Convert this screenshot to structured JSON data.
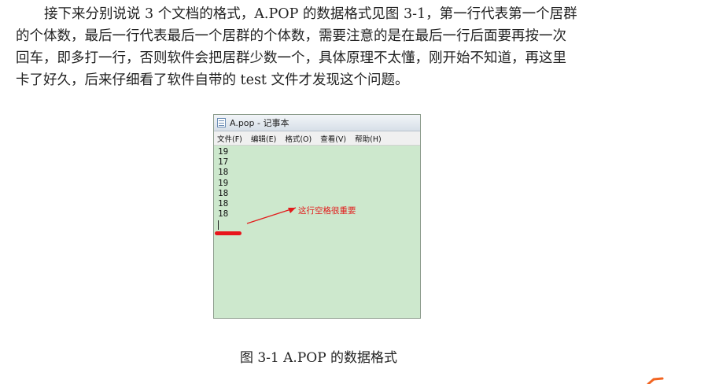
{
  "paragraph": {
    "lines": [
      "接下来分别说说 3 个文档的格式，A.POP 的数据格式见图 3-1，第一行代表第一个居群",
      "的个体数，最后一行代表最后一个居群的个体数，需要注意的是在最后一行后面要再按一次",
      "回车，即多打一行，否则软件会把居群少数一个，具体原理不太懂，刚开始不知道，再这里",
      "卡了好久，后来仔细看了软件自带的 test 文件才发现这个问题。"
    ]
  },
  "notepad": {
    "title": "A.pop - 记事本",
    "menu": [
      "文件(F)",
      "编辑(E)",
      "格式(O)",
      "查看(V)",
      "帮助(H)"
    ],
    "lines": [
      "19",
      "17",
      "18",
      "19",
      "18",
      "18",
      "18"
    ],
    "annotation": "这行空格很重要",
    "colors": {
      "background": "#cde8cd",
      "annotation": "#e21b1b"
    }
  },
  "caption": "图 3-1 A.POP 的数据格式"
}
